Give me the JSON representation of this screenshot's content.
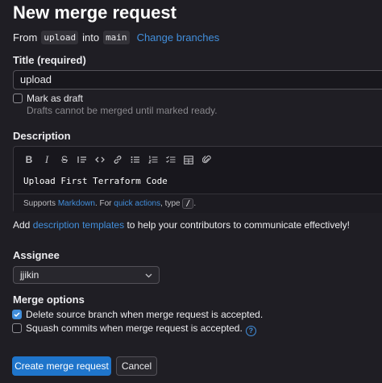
{
  "page": {
    "title": "New merge request",
    "from_prefix": "From",
    "source_branch": "upload",
    "into_text": "into",
    "target_branch": "main",
    "change_branches": "Change branches"
  },
  "title_field": {
    "label": "Title (required)",
    "value": "upload"
  },
  "draft": {
    "label": "Mark as draft",
    "help": "Drafts cannot be merged until marked ready.",
    "checked": false
  },
  "description": {
    "label": "Description",
    "toolbar": [
      {
        "icon": "bold-icon",
        "glyph": "B"
      },
      {
        "icon": "italic-icon",
        "glyph": "I"
      },
      {
        "icon": "strikethrough-icon",
        "glyph": "S"
      },
      {
        "icon": "quote-icon",
        "glyph": "quote"
      },
      {
        "icon": "code-icon",
        "glyph": "</>"
      },
      {
        "icon": "link-icon",
        "glyph": "link"
      },
      {
        "icon": "bulleted-list-icon",
        "glyph": "ul"
      },
      {
        "icon": "numbered-list-icon",
        "glyph": "ol"
      },
      {
        "icon": "task-list-icon",
        "glyph": "task"
      },
      {
        "icon": "table-icon",
        "glyph": "table"
      },
      {
        "icon": "attachment-icon",
        "glyph": "clip"
      }
    ],
    "value": "Upload First Terraform Code",
    "footer_prefix": "Supports",
    "footer_markdown": "Markdown",
    "footer_mid": ". For",
    "footer_quick_actions": "quick actions",
    "footer_type": ", type",
    "footer_key": "/",
    "footer_end": ".",
    "templates_prefix": "Add",
    "templates_link": "description templates",
    "templates_suffix": "to help your contributors to communicate effectively!"
  },
  "assignee": {
    "label": "Assignee",
    "value": "jjikin"
  },
  "merge_options": {
    "label": "Merge options",
    "delete_source": {
      "label": "Delete source branch when merge request is accepted.",
      "checked": true
    },
    "squash": {
      "label": "Squash commits when merge request is accepted.",
      "checked": false
    }
  },
  "actions": {
    "create": "Create merge request",
    "cancel": "Cancel"
  },
  "colors": {
    "background": "#1f1e24",
    "link": "#428fdc",
    "primary": "#1f75cb"
  }
}
